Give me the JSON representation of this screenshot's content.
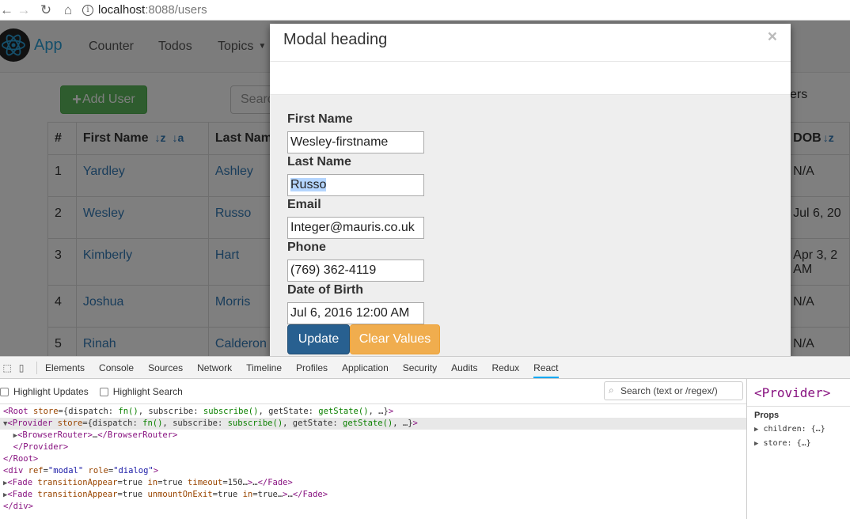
{
  "browser": {
    "url_host": "localhost",
    "url_port_path": ":8088/users"
  },
  "navbar": {
    "brand": "App",
    "links": [
      "Counter",
      "Todos",
      "Topics"
    ]
  },
  "toolbar": {
    "add_user_label": "Add User",
    "search_placeholder": "Search",
    "behind_text": "ers"
  },
  "table": {
    "headers": [
      "#",
      "First Name",
      "Last Name",
      "DOB"
    ],
    "rows": [
      {
        "id": "1",
        "first": "Yardley",
        "last": "Ashley",
        "dob": "N/A"
      },
      {
        "id": "2",
        "first": "Wesley",
        "last": "Russo",
        "dob": "Jul 6, 20"
      },
      {
        "id": "3",
        "first": "Kimberly",
        "last": "Hart",
        "dob": "Apr 3, 2",
        "dob2": "AM"
      },
      {
        "id": "4",
        "first": "Joshua",
        "last": "Morris",
        "dob": "N/A"
      },
      {
        "id": "5",
        "first": "Rinah",
        "last": "Calderon",
        "dob": "N/A"
      }
    ]
  },
  "modal": {
    "title": "Modal heading",
    "close": "×",
    "fields": {
      "first_name_label": "First Name",
      "first_name_value": "Wesley-firstname",
      "last_name_label": "Last Name",
      "last_name_value": "Russo",
      "email_label": "Email",
      "email_value": "Integer@mauris.co.uk",
      "phone_label": "Phone",
      "phone_value": "(769) 362-4119",
      "dob_label": "Date of Birth",
      "dob_value": "Jul 6, 2016 12:00 AM"
    },
    "update_label": "Update",
    "clear_label": "Clear Values"
  },
  "devtools": {
    "tabs": [
      "Elements",
      "Console",
      "Sources",
      "Network",
      "Timeline",
      "Profiles",
      "Application",
      "Security",
      "Audits",
      "Redux",
      "React"
    ],
    "active_tab": "React",
    "highlight_updates": "Highlight Updates",
    "highlight_search": "Highlight Search",
    "search_placeholder": "Search (text or /regex/)",
    "selected_component": "<Provider>",
    "props_heading": "Props",
    "props": [
      "children: {…}",
      "store: {…}"
    ]
  }
}
